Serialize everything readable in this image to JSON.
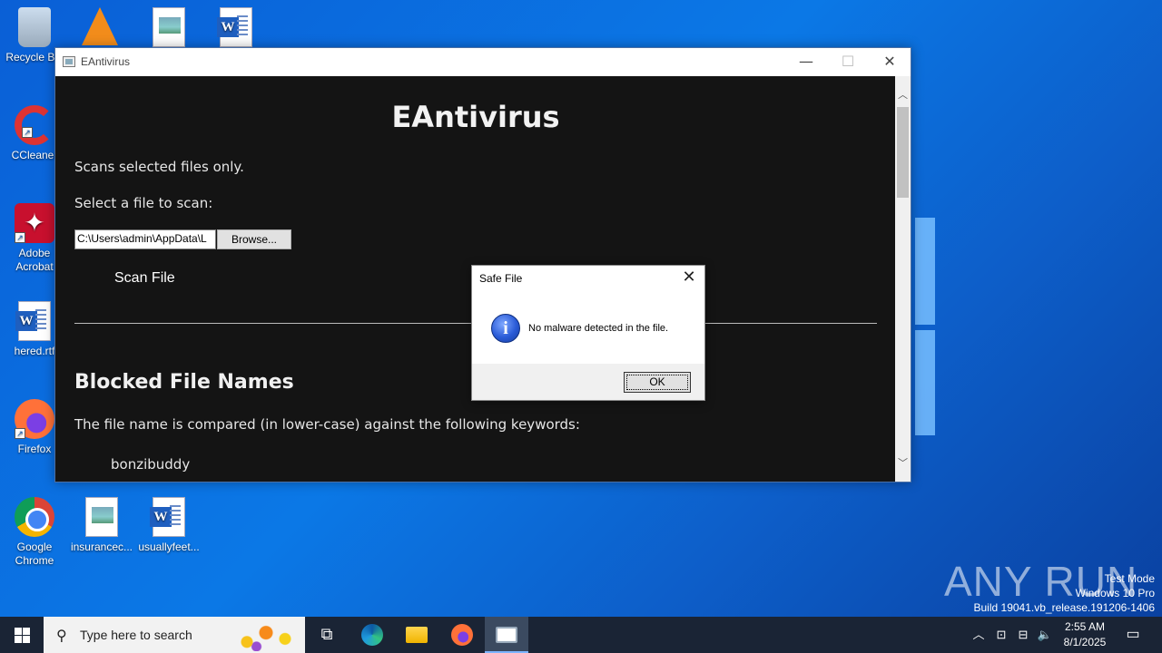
{
  "desktop": {
    "icons": [
      {
        "label": "Recycle Bin"
      },
      {
        "label": ""
      },
      {
        "label": ""
      },
      {
        "label": ""
      },
      {
        "label": "CCleaner"
      },
      {
        "label": "Adobe Acrobat"
      },
      {
        "label": "hered.rtf"
      },
      {
        "label": "Firefox"
      },
      {
        "label": "Google Chrome"
      },
      {
        "label": "insurancec..."
      },
      {
        "label": "usuallyfeet..."
      }
    ]
  },
  "window": {
    "title": "EAntivirus",
    "minimize": "—",
    "maximize": "☐",
    "close": "✕"
  },
  "app": {
    "heading": "EAntivirus",
    "subtitle": "Scans selected files only.",
    "select_label": "Select a file to scan:",
    "file_path": "C:\\Users\\admin\\AppData\\L",
    "browse_label": "Browse...",
    "scan_label": "Scan File",
    "blocked_title": "Blocked File Names",
    "blocked_desc": "The file name is compared (in lower-case) against the following keywords:",
    "keywords": [
      "bonzibuddy"
    ]
  },
  "dialog": {
    "title": "Safe File",
    "message": "No malware detected in the file.",
    "ok_label": "OK",
    "icon": "info-icon"
  },
  "watermark": {
    "line1": "Test Mode",
    "line2": "Windows 10 Pro",
    "line3": "Build 19041.vb_release.191206-1406",
    "brand": "ANY RUN"
  },
  "taskbar": {
    "search_placeholder": "Type here to search",
    "time": "2:55 AM",
    "date": "8/1/2025"
  }
}
